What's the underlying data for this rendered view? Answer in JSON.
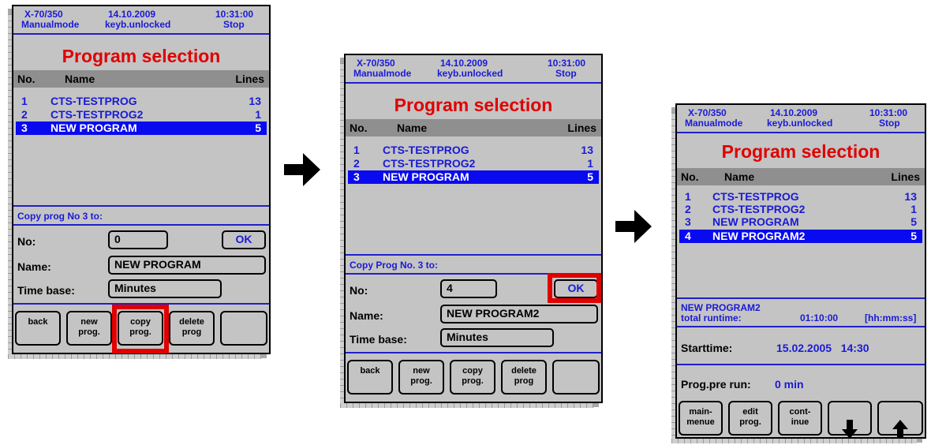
{
  "screens": [
    {
      "header": {
        "model": "X-70/350",
        "mode": "Manualmode",
        "date": "14.10.2009",
        "kb": "keyb.unlocked",
        "time": "10:31:00",
        "state": "Stop"
      },
      "title": "Program selection",
      "columns": {
        "no": "No.",
        "name": "Name",
        "lines": "Lines"
      },
      "rows": [
        {
          "no": "1",
          "name": "CTS-TESTPROG",
          "lines": "13"
        },
        {
          "no": "2",
          "name": "CTS-TESTPROG2",
          "lines": "1"
        },
        {
          "no": "3",
          "name": "NEW PROGRAM",
          "lines": "5"
        }
      ],
      "selected_row": 3,
      "copy_label": "Copy prog No 3 to:",
      "form": {
        "no_label": "No:",
        "no_value": "0",
        "ok": "OK",
        "name_label": "Name:",
        "name_value": "NEW PROGRAM",
        "timebase_label": "Time base:",
        "timebase_value": "Minutes"
      },
      "softkeys": [
        "back",
        "new\nprog.",
        "copy\nprog.",
        "delete\nprog",
        ""
      ]
    },
    {
      "header": {
        "model": "X-70/350",
        "mode": "Manualmode",
        "date": "14.10.2009",
        "kb": "keyb.unlocked",
        "time": "10:31:00",
        "state": "Stop"
      },
      "title": "Program selection",
      "columns": {
        "no": "No.",
        "name": "Name",
        "lines": "Lines"
      },
      "rows": [
        {
          "no": "1",
          "name": "CTS-TESTPROG",
          "lines": "13"
        },
        {
          "no": "2",
          "name": "CTS-TESTPROG2",
          "lines": "1"
        },
        {
          "no": "3",
          "name": "NEW PROGRAM",
          "lines": "5"
        }
      ],
      "selected_row": 3,
      "copy_label": "Copy Prog No. 3 to:",
      "form": {
        "no_label": "No:",
        "no_value": "4",
        "ok": "OK",
        "name_label": "Name:",
        "name_value": "NEW PROGRAM2",
        "timebase_label": "Time base:",
        "timebase_value": "Minutes"
      },
      "softkeys": [
        "back",
        "new\nprog.",
        "copy\nprog.",
        "delete\nprog",
        ""
      ]
    },
    {
      "header": {
        "model": "X-70/350",
        "mode": "Manualmode",
        "date": "14.10.2009",
        "kb": "keyb.unlocked",
        "time": "10:31:00",
        "state": "Stop"
      },
      "title": "Program selection",
      "columns": {
        "no": "No.",
        "name": "Name",
        "lines": "Lines"
      },
      "rows": [
        {
          "no": "1",
          "name": "CTS-TESTPROG",
          "lines": "13"
        },
        {
          "no": "2",
          "name": "CTS-TESTPROG2",
          "lines": "1"
        },
        {
          "no": "3",
          "name": "NEW PROGRAM",
          "lines": "5"
        },
        {
          "no": "4",
          "name": "NEW PROGRAM2",
          "lines": "5"
        }
      ],
      "selected_row": 4,
      "info": {
        "prog_name": "NEW PROGRAM2",
        "runtime_label": "total runtime:",
        "runtime_value": "01:10:00",
        "runtime_unit": "[hh:mm:ss]"
      },
      "start": {
        "label": "Starttime:",
        "value": "15.02.2005   14:30"
      },
      "prerun": {
        "label": "Prog.pre run:",
        "value": "0 min"
      },
      "softkeys": [
        "main-\nmenue",
        "edit\nprog.",
        "cont-\ninue",
        "arrow-down-icon",
        "arrow-up-icon"
      ]
    }
  ],
  "highlights": [
    "copy-prog-button (screen 1)",
    "ok-button (screen 2)"
  ],
  "colors": {
    "panel": "#c4c4c4",
    "blue": "#1a1ad6",
    "title_red": "#e00000",
    "selection": "#0a0af0",
    "highlight_red": "#e00000"
  }
}
